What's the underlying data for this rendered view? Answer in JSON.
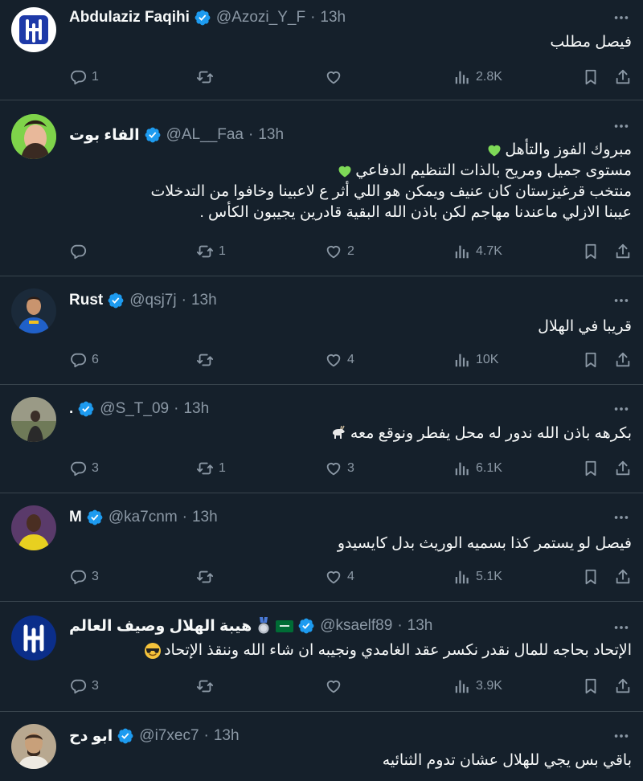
{
  "tweets": [
    {
      "name": "Abdulaziz Faqihi",
      "handle": "@Azozi_Y_F",
      "time": "13h",
      "lines": [
        "فيصل مطلب"
      ],
      "replies": "1",
      "retweets": "",
      "likes": "",
      "views": "2.8K"
    },
    {
      "name": "الفاء بوت",
      "handle": "@AL__Faa",
      "time": "13h",
      "lines": [
        "مبروك الفوز والتأهل",
        "مستوى جميل ومريح بالذات التنظيم الدفاعي",
        "منتخب قرغيزستان كان عنيف ويمكن هو اللي أثر ع لاعبينا وخافوا من التدخلات",
        "عيبنا الازلي ماعندنا مهاجم لكن باذن الله البقية قادرين يجيبون الكأس ."
      ],
      "replies": "",
      "retweets": "1",
      "likes": "2",
      "views": "4.7K"
    },
    {
      "name": "Rust",
      "handle": "@qsj7j",
      "time": "13h",
      "lines": [
        "قريبا في الهلال"
      ],
      "replies": "6",
      "retweets": "",
      "likes": "4",
      "views": "10K"
    },
    {
      "name": ".",
      "handle": "@S_T_09",
      "time": "13h",
      "lines": [
        "بكرهه باذن الله ندور له محل يفطر ونوقع معه"
      ],
      "replies": "3",
      "retweets": "1",
      "likes": "3",
      "views": "6.1K"
    },
    {
      "name": "M",
      "handle": "@ka7cnm",
      "time": "13h",
      "lines": [
        "فيصل لو يستمر كذا بسميه الوريث بدل كايسيدو"
      ],
      "replies": "3",
      "retweets": "",
      "likes": "4",
      "views": "5.1K"
    },
    {
      "name": "هيبة الهلال وصيف العالم",
      "handle": "@ksaelf89",
      "time": "13h",
      "lines": [
        "الإتحاد بحاجه للمال نقدر نكسر عقد الغامدي ونجيبه ان شاء الله وننقذ الإتحاد"
      ],
      "replies": "3",
      "retweets": "",
      "likes": "",
      "views": "3.9K"
    },
    {
      "name": "ابو دح",
      "handle": "@i7xec7",
      "time": "13h",
      "lines": [
        "باقي بس يجي للهلال عشان تدوم الثنائيه"
      ],
      "replies": "",
      "retweets": "",
      "likes": "",
      "views": ""
    }
  ],
  "colors": {
    "background": "#15202b",
    "divider": "#38444d",
    "text": "#f7f9f9",
    "secondary": "#8b98a5",
    "verified": "#1d9bf0"
  },
  "icons": [
    "reply-icon",
    "retweet-icon",
    "like-icon",
    "views-icon",
    "bookmark-icon",
    "share-icon",
    "more-icon",
    "verified-icon"
  ]
}
